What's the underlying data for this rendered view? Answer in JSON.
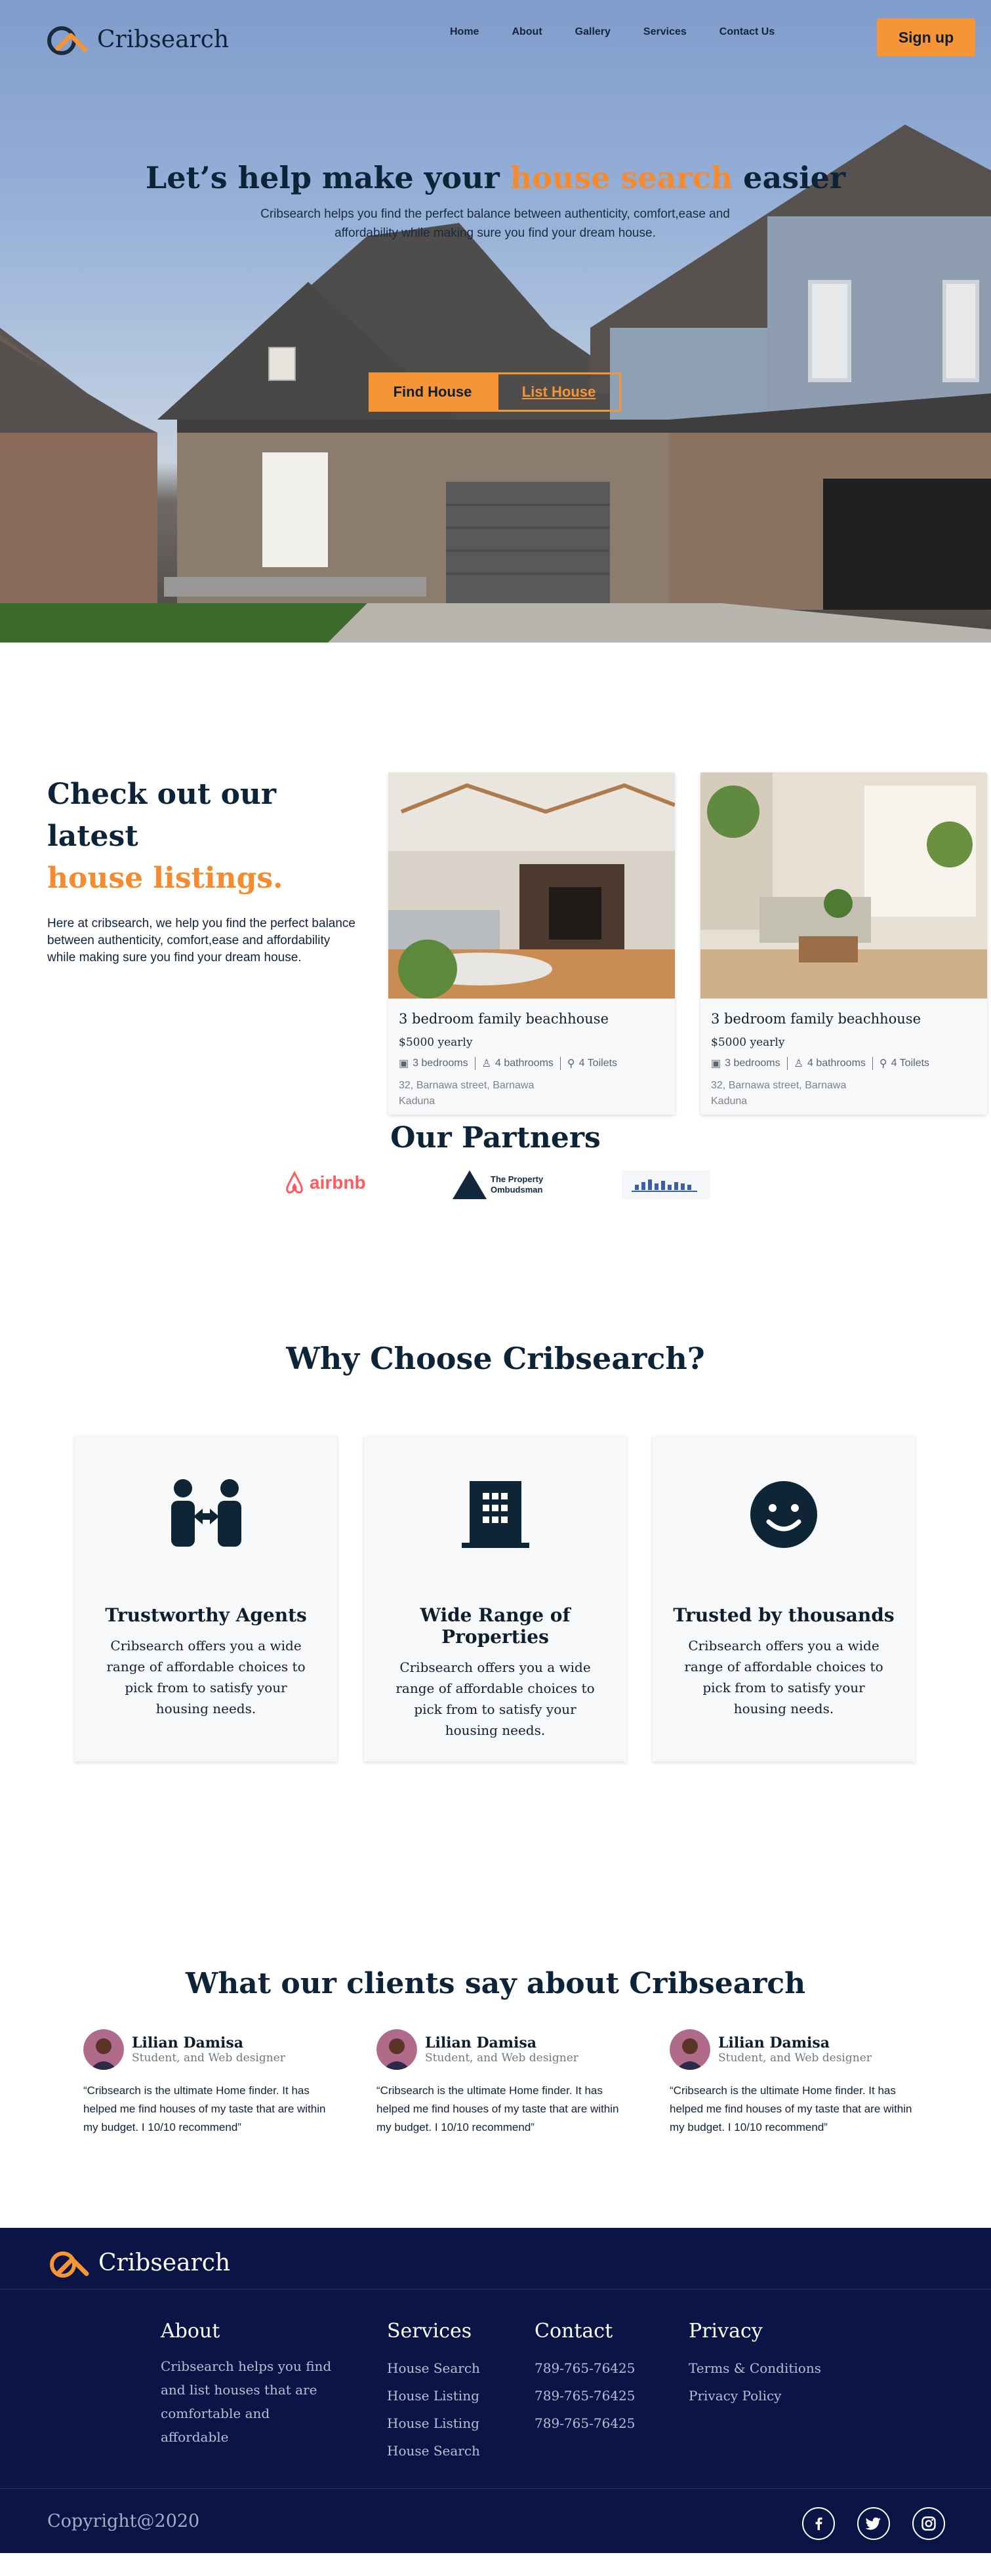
{
  "brand": {
    "name": "Cribsearch",
    "accent": "#f59535",
    "navy": "#0a1546",
    "logo_icon": "house-roof-logo-icon"
  },
  "nav": {
    "links": [
      "Home",
      "About",
      "Gallery",
      "Services",
      "Contact Us"
    ],
    "signup_label": "Sign up"
  },
  "hero": {
    "title_pre": "Let’s help make your ",
    "title_accent": "house search",
    "title_post": " easier",
    "subtitle": "Cribsearch helps you find the perfect balance between authenticity, comfort,ease and affordability while making sure you find your dream house.",
    "find_label": "Find House",
    "list_label": "List House"
  },
  "listings": {
    "heading": "Check out our latest",
    "heading_accent": "house listings.",
    "intro": "Here at cribsearch, we help you find the perfect balance between authenticity, comfort,ease and affordability while making sure you find your dream house.",
    "cards": [
      {
        "title": "3 bedroom family beachhouse",
        "price": "$5000 yearly",
        "bedrooms": "3 bedrooms",
        "bathrooms": "4 bathrooms",
        "toilets": "4 Toilets",
        "address": "32, Barnawa street, Barnawa Kaduna"
      },
      {
        "title": "3 bedroom family beachhouse",
        "price": "$5000 yearly",
        "bedrooms": "3 bedrooms",
        "bathrooms": "4 bathrooms",
        "toilets": "4 Toilets",
        "address": "32, Barnawa street, Barnawa Kaduna"
      }
    ]
  },
  "partners": {
    "heading": "Our Partners",
    "airbnb": "airbnb",
    "ombudsman_line1": "The Property",
    "ombudsman_line2": "Ombudsman"
  },
  "why": {
    "heading": "Why Choose Cribsearch?",
    "features": [
      {
        "icon": "agents-exchange-icon",
        "title": "Trustworthy Agents",
        "text": "Cribsearch offers you a wide range of affordable choices to pick from to satisfy your housing needs."
      },
      {
        "icon": "building-icon",
        "title": "Wide Range of Properties",
        "text": "Cribsearch offers you a wide range of affordable choices to pick from to satisfy your housing needs."
      },
      {
        "icon": "smiley-icon",
        "title": "Trusted by thousands",
        "text": "Cribsearch offers you a wide range of affordable choices to pick from to satisfy your housing needs."
      }
    ]
  },
  "testimonials": {
    "heading": "What our clients say about Cribsearch",
    "items": [
      {
        "name": "Lilian Damisa",
        "role": "Student, and Web designer",
        "quote": "“Cribsearch is the ultimate Home finder. It has helped me find houses of my taste that are within my budget. I 10/10 recommend”"
      },
      {
        "name": "Lilian Damisa",
        "role": "Student, and Web designer",
        "quote": "“Cribsearch is the ultimate Home finder. It has helped me find houses of my taste that are within my budget. I 10/10 recommend”"
      },
      {
        "name": "Lilian Damisa",
        "role": "Student, and Web designer",
        "quote": "“Cribsearch is the ultimate Home finder. It has helped me find houses of my taste that are within my budget. I 10/10 recommend”"
      }
    ]
  },
  "footer": {
    "about": {
      "heading": "About",
      "text": "Cribsearch helps you find and list houses that are comfortable and affordable"
    },
    "services": {
      "heading": "Services",
      "items": [
        "House Search",
        "House Listing",
        "House Listing",
        "House Search"
      ]
    },
    "contact": {
      "heading": "Contact",
      "items": [
        "789-765-76425",
        "789-765-76425",
        "789-765-76425"
      ]
    },
    "privacy": {
      "heading": "Privacy",
      "items": [
        "Terms & Conditions",
        "Privacy Policy"
      ]
    },
    "copyright": "Copyright@2020",
    "socials": [
      "facebook-icon",
      "twitter-icon",
      "instagram-icon"
    ]
  }
}
